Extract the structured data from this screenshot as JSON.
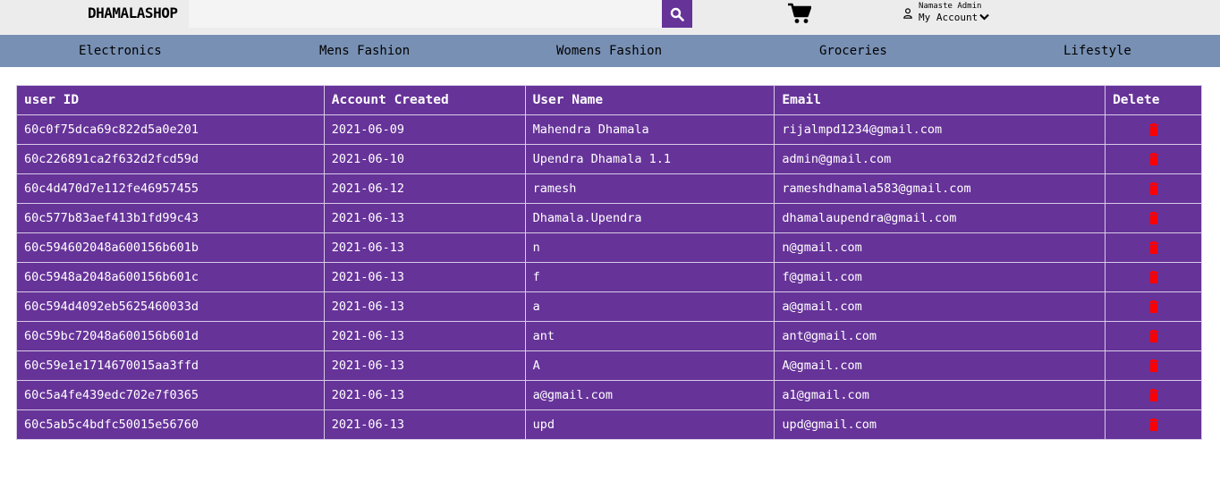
{
  "header": {
    "logo": "DHAMALASHOP",
    "search_placeholder": "",
    "account_greeting": "Namaste Admin",
    "account_label": "My Account"
  },
  "nav": [
    "Electronics",
    "Mens Fashion",
    "Womens Fashion",
    "Groceries",
    "Lifestyle"
  ],
  "table": {
    "columns": [
      "user ID",
      "Account Created",
      "User Name",
      "Email",
      "Delete"
    ],
    "rows": [
      {
        "id": "60c0f75dca69c822d5a0e201",
        "created": "2021-06-09",
        "name": "Mahendra Dhamala",
        "email": "rijalmpd1234@gmail.com"
      },
      {
        "id": "60c226891ca2f632d2fcd59d",
        "created": "2021-06-10",
        "name": "Upendra Dhamala 1.1",
        "email": "admin@gmail.com"
      },
      {
        "id": "60c4d470d7e112fe46957455",
        "created": "2021-06-12",
        "name": "ramesh",
        "email": "rameshdhamala583@gmail.com"
      },
      {
        "id": "60c577b83aef413b1fd99c43",
        "created": "2021-06-13",
        "name": "Dhamala.Upendra",
        "email": "dhamalaupendra@gmail.com"
      },
      {
        "id": "60c594602048a600156b601b",
        "created": "2021-06-13",
        "name": "n",
        "email": "n@gmail.com"
      },
      {
        "id": "60c5948a2048a600156b601c",
        "created": "2021-06-13",
        "name": "f",
        "email": "f@gmail.com"
      },
      {
        "id": "60c594d4092eb5625460033d",
        "created": "2021-06-13",
        "name": "a",
        "email": "a@gmail.com"
      },
      {
        "id": "60c59bc72048a600156b601d",
        "created": "2021-06-13",
        "name": "ant",
        "email": "ant@gmail.com"
      },
      {
        "id": "60c59e1e1714670015aa3ffd",
        "created": "2021-06-13",
        "name": "A",
        "email": "A@gmail.com"
      },
      {
        "id": "60c5a4fe439edc702e7f0365",
        "created": "2021-06-13",
        "name": "a@gmail.com",
        "email": "a1@gmail.com"
      },
      {
        "id": "60c5ab5c4bdfc50015e56760",
        "created": "2021-06-13",
        "name": "upd",
        "email": "upd@gmail.com"
      }
    ]
  },
  "icons": {
    "search": "search-icon",
    "cart": "cart-icon",
    "user": "user-icon",
    "chevron": "chevron-down-icon",
    "delete": "trash-icon"
  },
  "colors": {
    "accent": "#663399",
    "nav_bg": "#7890b4",
    "topbar_bg": "#ececec",
    "delete": "#ff0000"
  }
}
